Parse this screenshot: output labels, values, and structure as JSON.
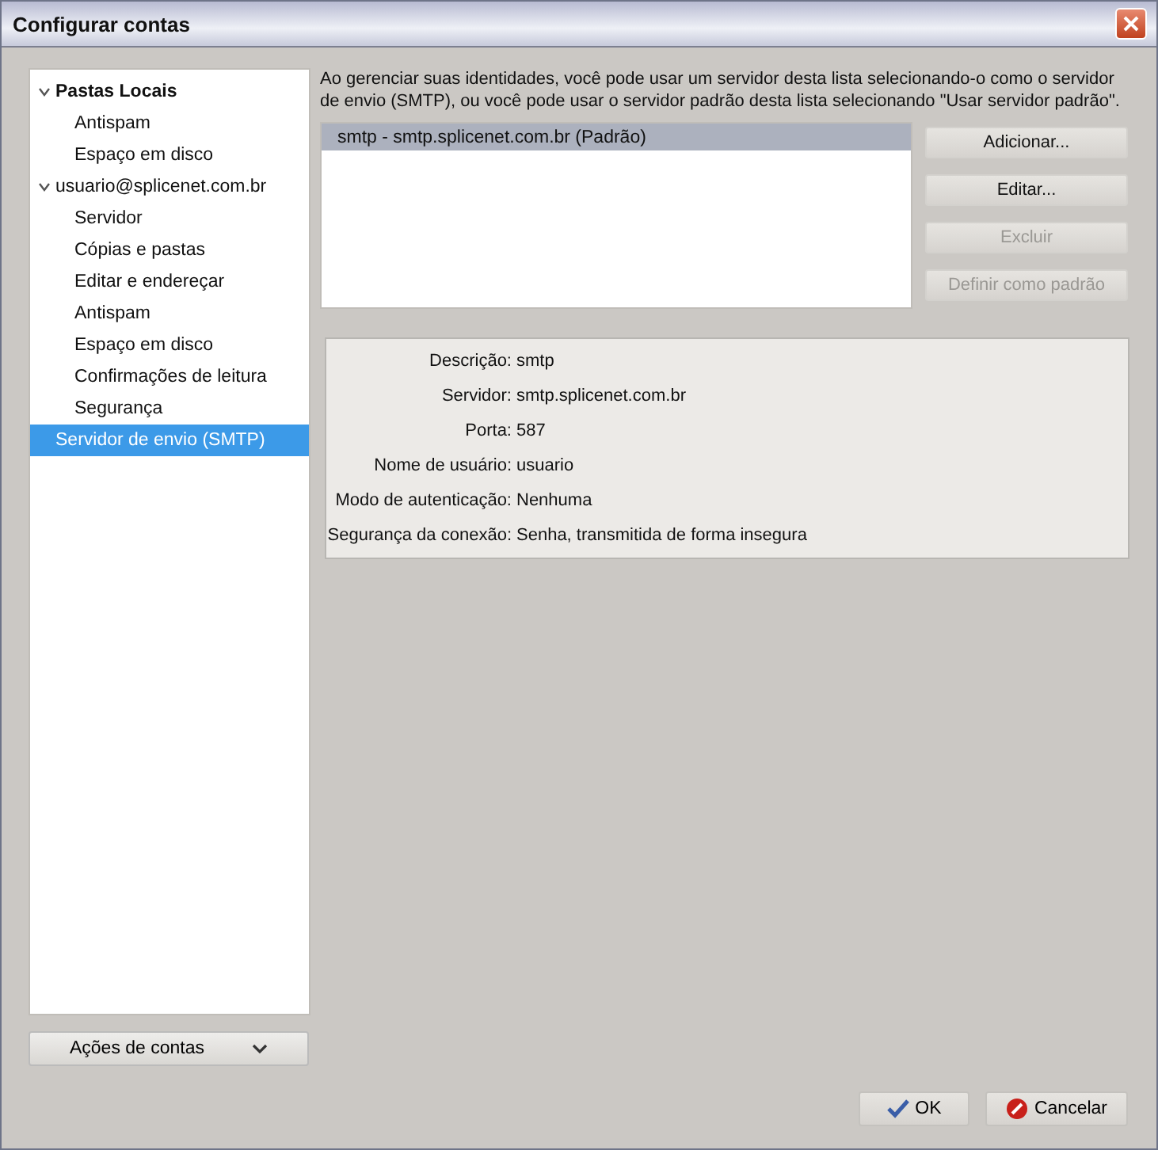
{
  "window": {
    "title": "Configurar contas"
  },
  "sidebar": {
    "tree": [
      {
        "label": "Pastas Locais",
        "bold": true,
        "expanded": true,
        "selected": false,
        "children": [
          {
            "label": "Antispam",
            "selected": false
          },
          {
            "label": "Espaço em disco",
            "selected": false
          }
        ]
      },
      {
        "label": "usuario@splicenet.com.br",
        "bold": false,
        "expanded": true,
        "selected": false,
        "children": [
          {
            "label": "Servidor",
            "selected": false
          },
          {
            "label": "Cópias e pastas",
            "selected": false
          },
          {
            "label": "Editar e endereçar",
            "selected": false
          },
          {
            "label": "Antispam",
            "selected": false
          },
          {
            "label": "Espaço em disco",
            "selected": false
          },
          {
            "label": "Confirmações de leitura",
            "selected": false
          },
          {
            "label": "Segurança",
            "selected": false
          }
        ]
      },
      {
        "label": "Servidor de envio (SMTP)",
        "bold": false,
        "selected": true
      }
    ],
    "actions_button": "Ações de contas"
  },
  "description": "Ao gerenciar suas identidades, você pode usar um servidor desta lista selecionando-o como o servidor de envio (SMTP), ou você pode usar o servidor padrão desta lista selecionando \"Usar servidor padrão\".",
  "server_list": [
    {
      "label": "smtp - smtp.splicenet.com.br (Padrão)",
      "selected": true
    }
  ],
  "server_buttons": [
    {
      "label": "Adicionar...",
      "disabled": false
    },
    {
      "label": "Editar...",
      "disabled": false
    },
    {
      "label": "Excluir",
      "disabled": true
    },
    {
      "label": "Definir como padrão",
      "disabled": true
    }
  ],
  "details": [
    {
      "label": "Descrição:",
      "value": "smtp"
    },
    {
      "label": "Servidor:",
      "value": "smtp.splicenet.com.br"
    },
    {
      "label": "Porta:",
      "value": "587"
    },
    {
      "label": "Nome de usuário:",
      "value": "usuario"
    },
    {
      "label": "Modo de autenticação:",
      "value": "Nenhuma"
    },
    {
      "label": "Segurança da conexão:",
      "value": "Senha, transmitida de forma insegura"
    }
  ],
  "dialog_buttons": [
    {
      "label": "OK",
      "kind": "ok"
    },
    {
      "label": "Cancelar",
      "kind": "cancel"
    }
  ]
}
